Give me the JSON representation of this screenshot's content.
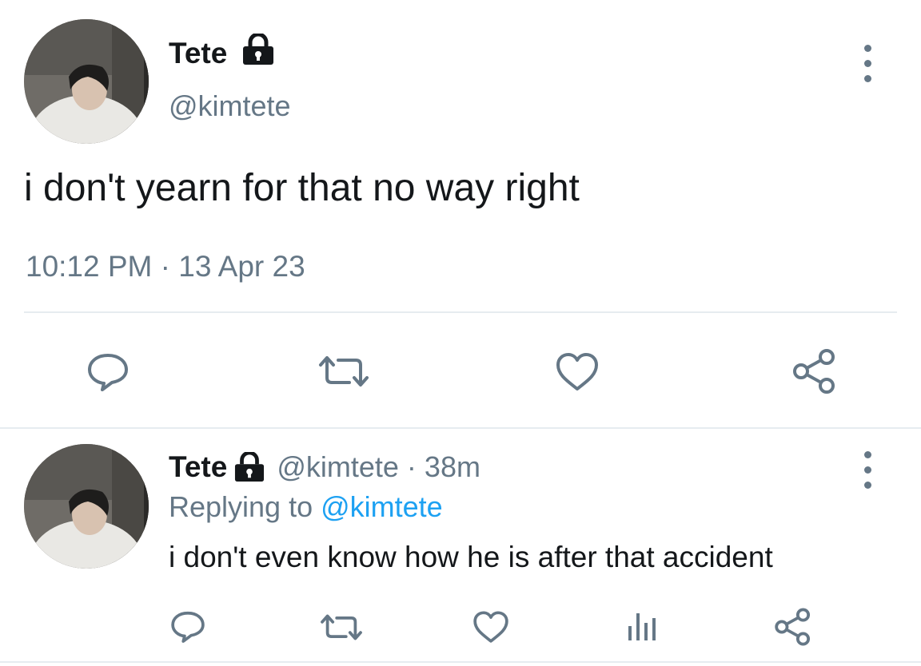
{
  "main_tweet": {
    "display_name": "Tete",
    "handle": "@kimtete",
    "text": "i don't yearn for that no way right",
    "time": "10:12 PM",
    "separator": "·",
    "date": "13 Apr 23"
  },
  "reply_tweet": {
    "display_name": "Tete",
    "handle": "@kimtete",
    "separator": "·",
    "age": "38m",
    "replying_label": "Replying to",
    "replying_to": "@kimtete",
    "text": "i don't even know how he is after that accident"
  },
  "colors": {
    "text": "#14171a",
    "secondary": "#657786",
    "accent": "#1da1f2",
    "divider": "#e6ecf0"
  },
  "icons": [
    "lock-icon",
    "more-icon",
    "reply-icon",
    "retweet-icon",
    "like-icon",
    "share-icon",
    "analytics-icon"
  ]
}
